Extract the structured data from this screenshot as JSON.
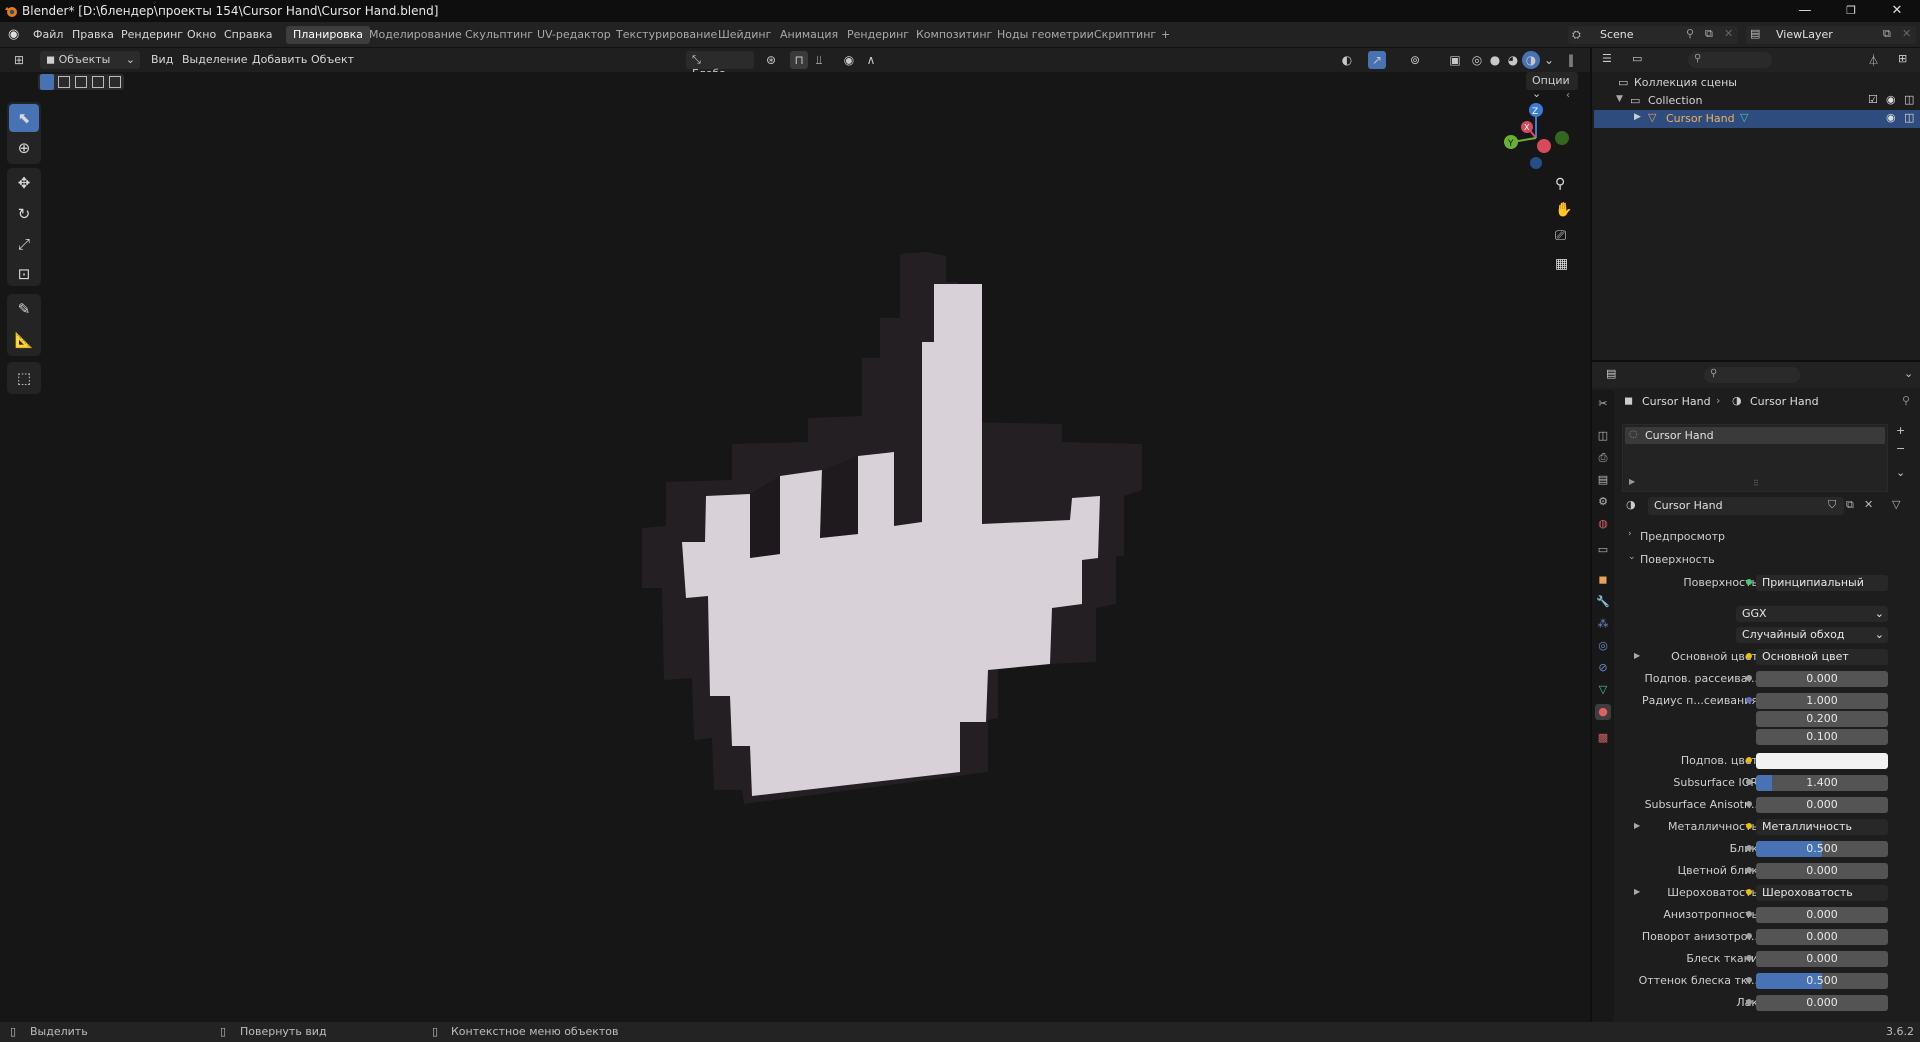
{
  "window": {
    "title": "Blender* [D:\\блендер\\проекты 154\\Cursor Hand\\Cursor Hand.blend]",
    "min": "—",
    "max": "❐",
    "close": "✕"
  },
  "menu": {
    "items": [
      "Файл",
      "Правка",
      "Рендеринг",
      "Окно",
      "Справка"
    ],
    "workspaces": [
      "Планировка",
      "Моделирование",
      "Скульптинг",
      "UV-редактор",
      "Текстурирование",
      "Шейдинг",
      "Анимация",
      "Рендеринг",
      "Композитинг",
      "Ноды геометрии",
      "Скриптинг"
    ],
    "add_ws": "+",
    "scene": "Scene",
    "view_layer": "ViewLayer"
  },
  "viewport_header": {
    "mode": "Объекты",
    "view": "Вид",
    "select": "Выделение",
    "add": "Добавить",
    "object": "Объект",
    "orientation": "Глоба...",
    "options": "Опции"
  },
  "gizmo": {
    "x": "X",
    "y": "Y",
    "z": "Z"
  },
  "outliner": {
    "scene_collection": "Коллекция сцены",
    "collection": "Collection",
    "object": "Cursor Hand"
  },
  "properties": {
    "breadcrumb_object": "Cursor Hand",
    "breadcrumb_material": "Cursor Hand",
    "slot_name": "Cursor Hand",
    "material_name": "Cursor Hand",
    "panel_preview": "Предпросмотр",
    "panel_surface": "Поверхность",
    "surface_label": "Поверхность",
    "surface_value": "Принципиальный BSDF",
    "distribution": "GGX",
    "subsurface_method": "Случайный обход",
    "rows": [
      {
        "label": "Основной цвет",
        "value": "Основной цвет",
        "type": "link"
      },
      {
        "label": "Подпов. рассеива...",
        "value": "0.000",
        "type": "num",
        "fill": 0
      },
      {
        "label": "Радиус п...сеивания",
        "value": "1.000",
        "type": "num",
        "fill": 0
      },
      {
        "label": "",
        "value": "0.200",
        "type": "num",
        "fill": 0
      },
      {
        "label": "",
        "value": "0.100",
        "type": "num",
        "fill": 0
      },
      {
        "label": "Подпов. цвет",
        "value": "",
        "type": "color"
      },
      {
        "label": "Subsurface IOR",
        "value": "1.400",
        "type": "num",
        "fill": 0.12
      },
      {
        "label": "Subsurface Anisotr...",
        "value": "0.000",
        "type": "num",
        "fill": 0
      },
      {
        "label": "Металличность",
        "value": "Металличность",
        "type": "link"
      },
      {
        "label": "Блик",
        "value": "0.500",
        "type": "num",
        "fill": 0.5
      },
      {
        "label": "Цветной блик",
        "value": "0.000",
        "type": "num",
        "fill": 0
      },
      {
        "label": "Шероховатость",
        "value": "Шероховатость",
        "type": "link"
      },
      {
        "label": "Анизотропность",
        "value": "0.000",
        "type": "num",
        "fill": 0
      },
      {
        "label": "Поворот анизотро...",
        "value": "0.000",
        "type": "num",
        "fill": 0
      },
      {
        "label": "Блеск ткани",
        "value": "0.000",
        "type": "num",
        "fill": 0
      },
      {
        "label": "Оттенок блеска тк...",
        "value": "0.500",
        "type": "num",
        "fill": 0.5
      },
      {
        "label": "Лак",
        "value": "0.000",
        "type": "num",
        "fill": 0
      }
    ]
  },
  "statusbar": {
    "select": "Выделить",
    "rotate": "Повернуть вид",
    "context": "Контекстное меню объектов",
    "version": "3.6.2"
  },
  "colors": {
    "accent": "#4772b3",
    "selected": "#2e4c7e",
    "hand_light": "#d9d2d9",
    "hand_dark": "#2a2528"
  }
}
